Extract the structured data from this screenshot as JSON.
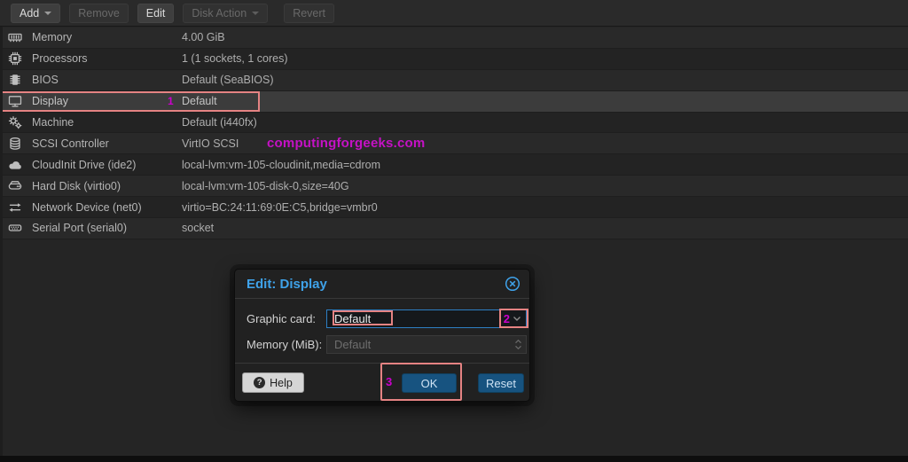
{
  "toolbar": {
    "buttons": [
      {
        "label": "Add",
        "disabled": false,
        "has_caret": true
      },
      {
        "label": "Remove",
        "disabled": true,
        "has_caret": false
      },
      {
        "label": "Edit",
        "disabled": false,
        "has_caret": false
      },
      {
        "label": "Disk Action",
        "disabled": true,
        "has_caret": true
      },
      {
        "label": "Revert",
        "disabled": true,
        "has_caret": false
      }
    ]
  },
  "hardware_rows": [
    {
      "icon": "memory-icon",
      "label": "Memory",
      "value": "4.00 GiB"
    },
    {
      "icon": "cpu-icon",
      "label": "Processors",
      "value": "1 (1 sockets, 1 cores)"
    },
    {
      "icon": "bios-chip-icon",
      "label": "BIOS",
      "value": "Default (SeaBIOS)"
    },
    {
      "icon": "display-icon",
      "label": "Display",
      "value": "Default",
      "selected": true
    },
    {
      "icon": "gears-icon",
      "label": "Machine",
      "value": "Default (i440fx)"
    },
    {
      "icon": "database-icon",
      "label": "SCSI Controller",
      "value": "VirtIO SCSI"
    },
    {
      "icon": "cloud-icon",
      "label": "CloudInit Drive (ide2)",
      "value": "local-lvm:vm-105-cloudinit,media=cdrom"
    },
    {
      "icon": "hdd-icon",
      "label": "Hard Disk (virtio0)",
      "value": "local-lvm:vm-105-disk-0,size=40G"
    },
    {
      "icon": "exchange-arrows-icon",
      "label": "Network Device (net0)",
      "value": "virtio=BC:24:11:69:0E:C5,bridge=vmbr0"
    },
    {
      "icon": "serial-port-icon",
      "label": "Serial Port (serial0)",
      "value": "socket"
    }
  ],
  "watermark": "computingforgeeks.com",
  "dialog": {
    "title": "Edit: Display",
    "close_icon": "circle-x-icon",
    "fields": [
      {
        "label": "Graphic card:",
        "value": "Default",
        "type": "combobox"
      },
      {
        "label": "Memory (MiB):",
        "placeholder": "Default",
        "type": "spinner",
        "disabled": true
      }
    ],
    "help_label": "Help",
    "help_icon": "question-circle-icon",
    "ok_label": "OK",
    "reset_label": "Reset"
  },
  "annotations": {
    "step1": "1",
    "step2": "2",
    "step3": "3"
  },
  "colors": {
    "accent_blue": "#3fa2e9",
    "button_blue": "#175380",
    "annotation_pink": "#e58383",
    "annotation_magenta": "#cc00cc",
    "watermark_magenta": "#c511c5",
    "combobox_focus_border": "#2d7fc4",
    "selected_row": "#3c3c3c"
  }
}
